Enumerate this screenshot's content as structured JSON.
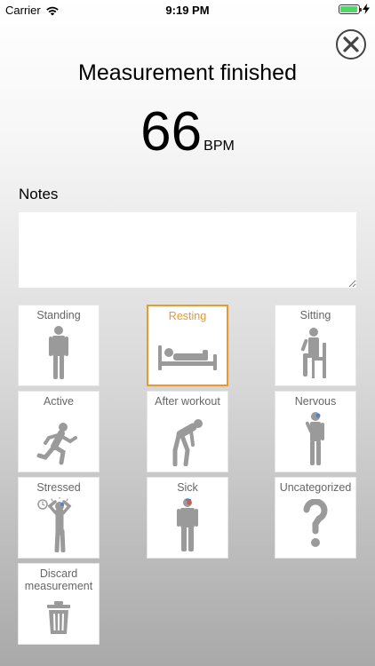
{
  "status_bar": {
    "carrier": "Carrier",
    "time": "9:19 PM",
    "battery_level": 0.95
  },
  "header": {
    "title": "Measurement finished",
    "close_icon": "close-circle-icon"
  },
  "measurement": {
    "value": "66",
    "unit": "BPM"
  },
  "notes": {
    "label": "Notes",
    "value": ""
  },
  "tags": [
    {
      "label": "Standing",
      "icon": "standing-person-icon",
      "selected": false
    },
    {
      "label": "Resting",
      "icon": "resting-bed-icon",
      "selected": true
    },
    {
      "label": "Sitting",
      "icon": "sitting-chair-icon",
      "selected": false
    },
    {
      "label": "Active",
      "icon": "running-person-icon",
      "selected": false
    },
    {
      "label": "After workout",
      "icon": "tired-person-icon",
      "selected": false
    },
    {
      "label": "Nervous",
      "icon": "nervous-person-icon",
      "selected": false
    },
    {
      "label": "Stressed",
      "icon": "stressed-person-icon",
      "selected": false
    },
    {
      "label": "Sick",
      "icon": "sick-person-icon",
      "selected": false
    },
    {
      "label": "Uncategorized",
      "icon": "question-mark-icon",
      "selected": false
    },
    {
      "label": "Discard measurement",
      "icon": "trash-icon",
      "selected": false
    }
  ],
  "colors": {
    "accent": "#f0962a",
    "icon_gray": "#9a9a9a",
    "battery_green": "#4cd964"
  }
}
